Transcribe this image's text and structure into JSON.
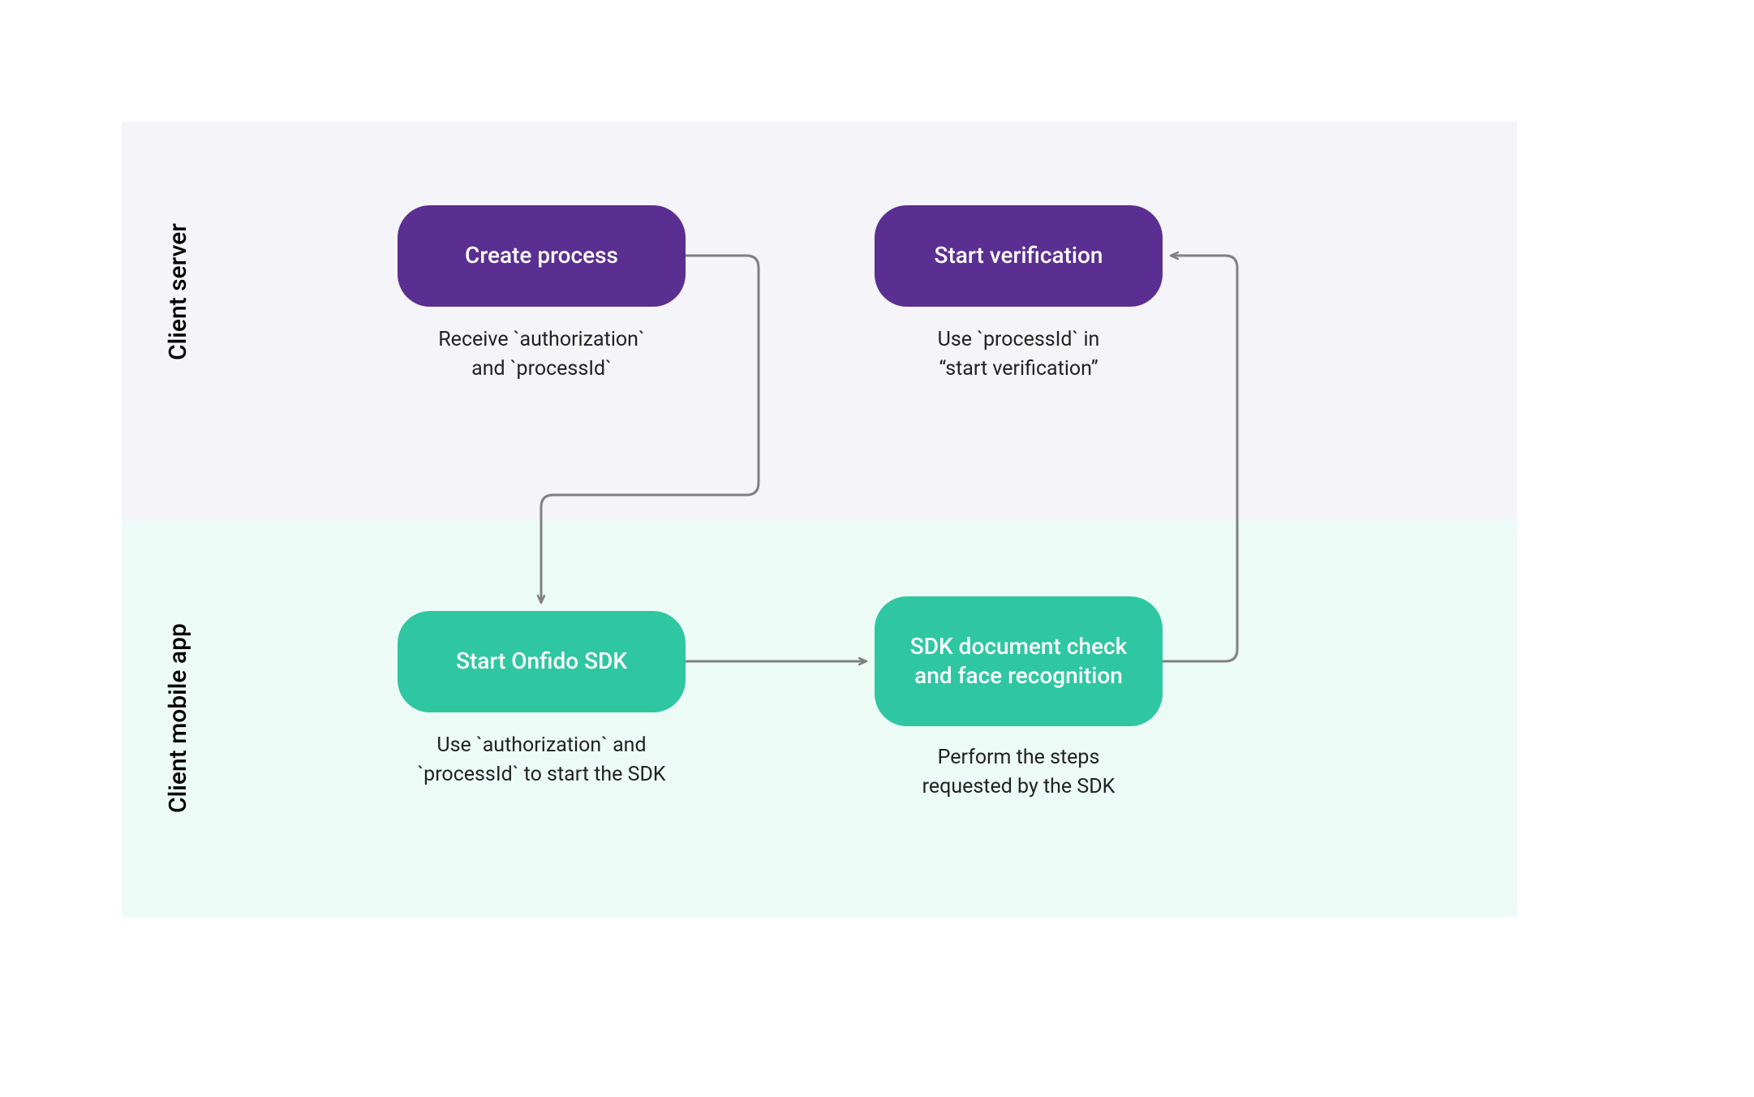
{
  "lanes": {
    "server": {
      "label": "Client server"
    },
    "mobile": {
      "label": "Client mobile app"
    }
  },
  "nodes": {
    "create_process": {
      "title": "Create process",
      "caption": "Receive `authorization`\nand `processId`"
    },
    "start_verification": {
      "title": "Start verification",
      "caption": "Use `processId` in\n“start verification”"
    },
    "start_sdk": {
      "title": "Start Onfido SDK",
      "caption": "Use `authorization` and\n`processId` to start the SDK"
    },
    "sdk_check": {
      "title": "SDK document check\nand face recognition",
      "caption": "Perform the steps\nrequested by the SDK"
    }
  },
  "colors": {
    "purple": "#5b2e91",
    "teal": "#2ec7a1",
    "server_bg": "#f4f4f9",
    "mobile_bg": "#edfbf7",
    "arrow": "#808080"
  }
}
